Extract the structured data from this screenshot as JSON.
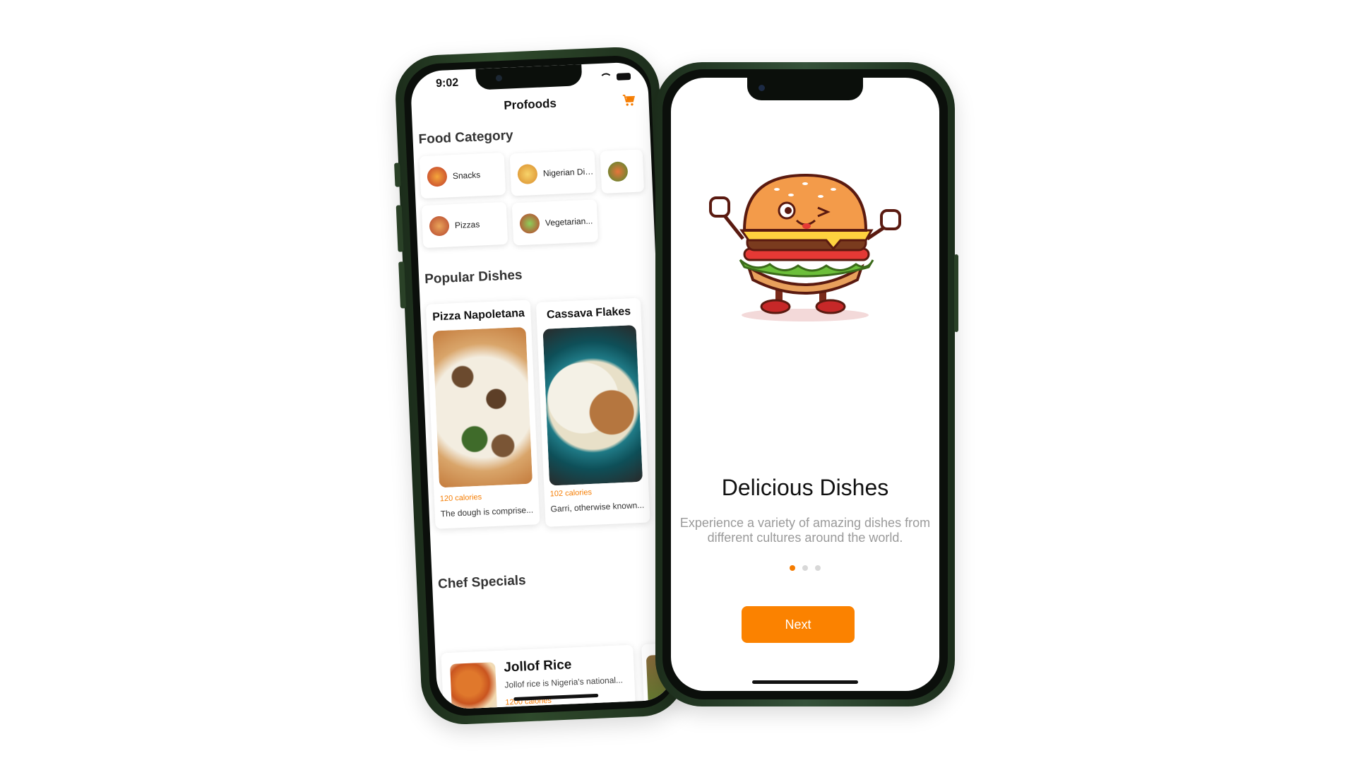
{
  "left_phone": {
    "status_time": "9:02",
    "app_title": "Profoods",
    "food_category_title": "Food Category",
    "categories": [
      {
        "label": "Snacks"
      },
      {
        "label": "Nigerian Dis..."
      },
      {
        "label": ""
      },
      {
        "label": "Pizzas"
      },
      {
        "label": "Vegetarian..."
      }
    ],
    "popular_title": "Popular Dishes",
    "dishes": [
      {
        "name": "Pizza Napoletana",
        "calories": "120 calories",
        "desc": "The dough is comprise..."
      },
      {
        "name": "Cassava Flakes",
        "calories": "102 calories",
        "desc": "Garri, otherwise known..."
      }
    ],
    "chef_specials_title": "Chef Specials",
    "special": {
      "name": "Jollof Rice",
      "desc": "Jollof rice is Nigeria's national...",
      "calories": "1200 calories"
    }
  },
  "right_phone": {
    "title": "Delicious Dishes",
    "description": "Experience a variety of amazing dishes from different cultures around the world.",
    "page_indicator": {
      "active": 1,
      "total": 3
    },
    "next_label": "Next"
  },
  "colors": {
    "accent": "#fb8200",
    "phone_frame": "#2f4a2c"
  },
  "icons": [
    "cart-icon",
    "wifi-icon",
    "battery-icon"
  ]
}
